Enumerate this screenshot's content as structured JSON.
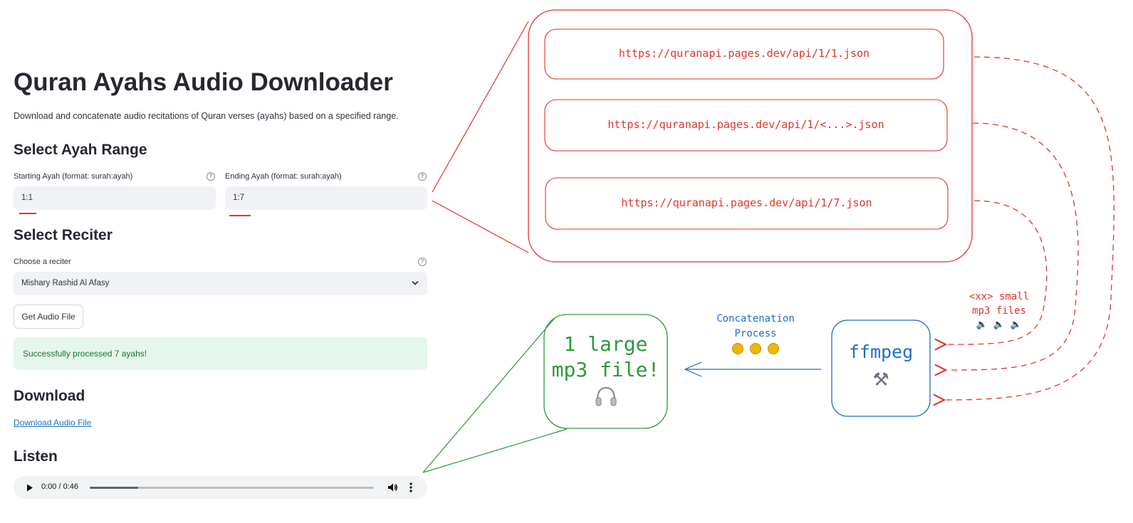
{
  "app": {
    "title": "Quran Ayahs Audio Downloader",
    "description": "Download and concatenate audio recitations of Quran verses (ayahs) based on a specified range."
  },
  "range_section": {
    "heading": "Select Ayah Range",
    "start_label": "Starting Ayah (format: surah:ayah)",
    "start_value": "1:1",
    "end_label": "Ending Ayah (format: surah:ayah)",
    "end_value": "1:7",
    "help_glyph": "?"
  },
  "reciter_section": {
    "heading": "Select Reciter",
    "label": "Choose a reciter",
    "selected": "Mishary Rashid Al Afasy",
    "dropdown_icon": "chevron-down-icon"
  },
  "actions": {
    "get_audio_label": "Get Audio File"
  },
  "status": {
    "success_message": "Successfully processed 7 ayahs!"
  },
  "download_section": {
    "heading": "Download",
    "link_label": "Download Audio File"
  },
  "listen_section": {
    "heading": "Listen",
    "time": "0:00 / 0:46",
    "progress": 0.17
  },
  "diagram": {
    "urls": [
      "https://quranapi.pages.dev/api/1/1.json",
      "https://quranapi.pages.dev/api/1/<...>.json",
      "https://quranapi.pages.dev/api/1/7.json"
    ],
    "small_files_line1": "<xx> small",
    "small_files_line2": "mp3 files",
    "small_files_icons": "speaker-icon",
    "ffmpeg_label": "ffmpeg",
    "ffmpeg_icon": "hammer-wrench-icon",
    "concat_line1": "Concatenation",
    "concat_line2": "Process",
    "concat_icons": "handshake-icon",
    "result_line1": "1 large",
    "result_line2": "mp3 file!",
    "result_icon": "headphones-icon",
    "colors": {
      "red": "#e0352b",
      "blue": "#1f6fc4",
      "green": "#2c9a3a"
    }
  }
}
